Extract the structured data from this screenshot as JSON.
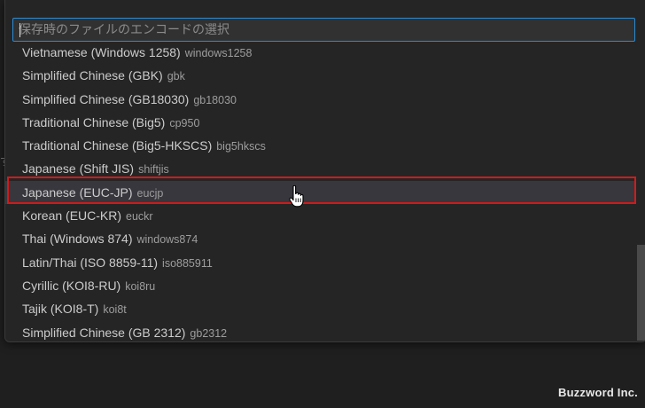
{
  "quick_pick": {
    "placeholder": "保存時のファイルのエンコードの選択",
    "items": [
      {
        "label": "Vietnamese (Windows 1258)",
        "desc": "windows1258"
      },
      {
        "label": "Simplified Chinese (GBK)",
        "desc": "gbk"
      },
      {
        "label": "Simplified Chinese (GB18030)",
        "desc": "gb18030"
      },
      {
        "label": "Traditional Chinese (Big5)",
        "desc": "cp950"
      },
      {
        "label": "Traditional Chinese (Big5-HKSCS)",
        "desc": "big5hkscs"
      },
      {
        "label": "Japanese (Shift JIS)",
        "desc": "shiftjis"
      },
      {
        "label": "Japanese (EUC-JP)",
        "desc": "eucjp"
      },
      {
        "label": "Korean (EUC-KR)",
        "desc": "euckr"
      },
      {
        "label": "Thai (Windows 874)",
        "desc": "windows874"
      },
      {
        "label": "Latin/Thai (ISO 8859-11)",
        "desc": "iso885911"
      },
      {
        "label": "Cyrillic (KOI8-RU)",
        "desc": "koi8ru"
      },
      {
        "label": "Tajik (KOI8-T)",
        "desc": "koi8t"
      },
      {
        "label": "Simplified Chinese (GB 2312)",
        "desc": "gb2312"
      }
    ]
  },
  "editor": {
    "edge_glyph": "す"
  },
  "watermark": "Buzzword Inc.",
  "colors": {
    "background": "#1f1f1f",
    "panel": "#252526",
    "input_border": "#2a8ad4",
    "active_row": "#37373d",
    "highlight_box": "#d11a1a"
  },
  "icons": {
    "cursor": "hand-pointer-icon"
  }
}
